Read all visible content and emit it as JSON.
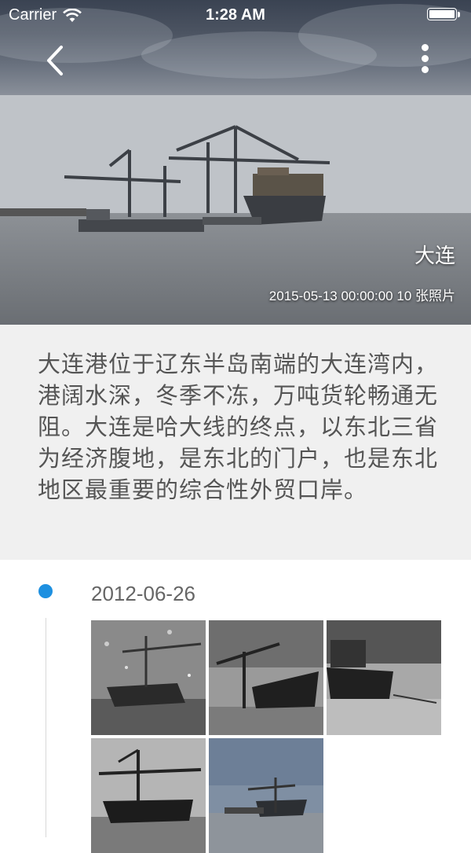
{
  "status_bar": {
    "carrier": "Carrier",
    "time": "1:28 AM",
    "wifi_icon": "wifi-icon",
    "battery_icon": "battery-icon"
  },
  "nav": {
    "back_icon": "chevron-left-icon",
    "more_icon": "more-vertical-icon"
  },
  "hero": {
    "title": "大连",
    "meta": "2015-05-13 00:00:00 10 张照片"
  },
  "description": "大连港位于辽东半岛南端的大连湾内，港阔水深，冬季不冻，万吨货轮畅通无阻。大连是哈大线的终点，以东北三省为经济腹地，是东北的门户，也是东北地区最重要的综合性外贸口岸。",
  "timeline": {
    "accent_color": "#1e90e0",
    "entries": [
      {
        "date": "2012-06-26",
        "photo_count_visible": 5
      }
    ]
  }
}
